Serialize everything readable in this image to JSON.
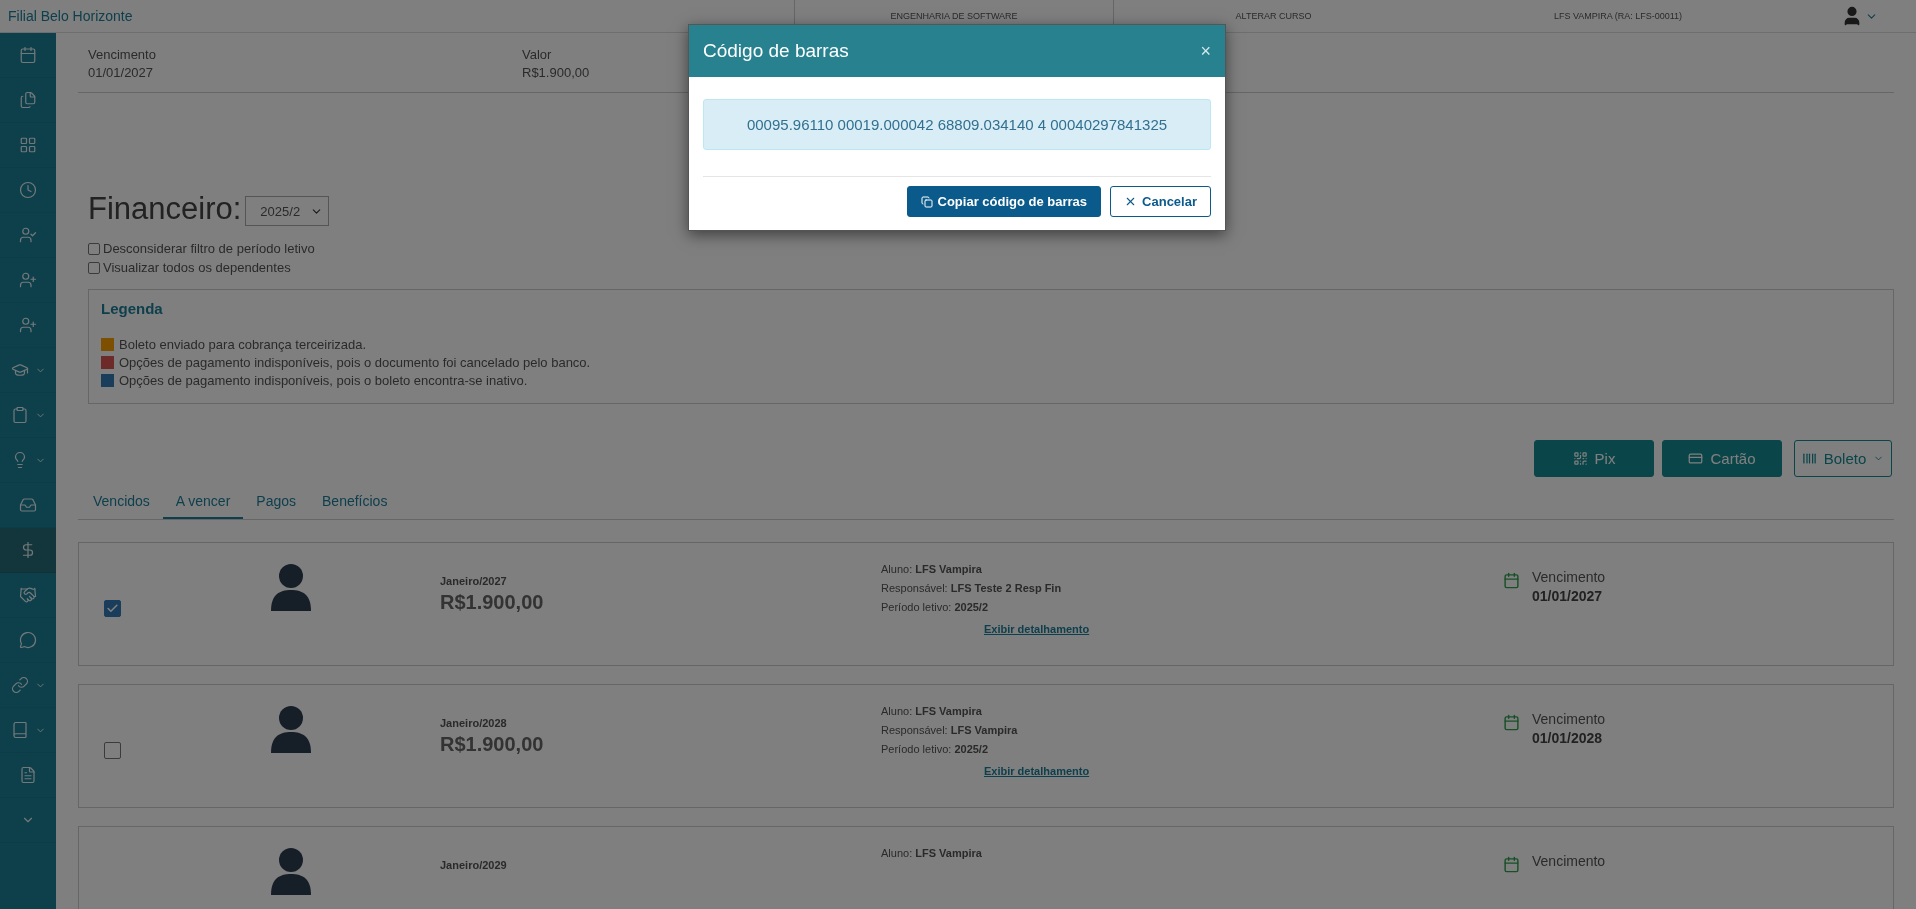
{
  "topbar": {
    "branch": "Filial Belo Horizonte",
    "course": "ENGENHARIA DE SOFTWARE",
    "change_course": "ALTERAR CURSO",
    "user": "LFS VAMPIRA (RA: LFS-00011)"
  },
  "sidebar": {
    "items": [
      {
        "selected": false,
        "has_submenu": false
      },
      {
        "selected": false,
        "has_submenu": false
      },
      {
        "selected": false,
        "has_submenu": false
      },
      {
        "selected": false,
        "has_submenu": false
      },
      {
        "selected": false,
        "has_submenu": false
      },
      {
        "selected": false,
        "has_submenu": false
      },
      {
        "selected": false,
        "has_submenu": false
      },
      {
        "selected": false,
        "has_submenu": true
      },
      {
        "selected": false,
        "has_submenu": true
      },
      {
        "selected": false,
        "has_submenu": true
      },
      {
        "selected": false,
        "has_submenu": false
      },
      {
        "selected": true,
        "has_submenu": false
      },
      {
        "selected": false,
        "has_submenu": false
      },
      {
        "selected": false,
        "has_submenu": false
      },
      {
        "selected": false,
        "has_submenu": true
      },
      {
        "selected": false,
        "has_submenu": true
      },
      {
        "selected": false,
        "has_submenu": false
      },
      {
        "selected": false,
        "has_submenu": false
      }
    ]
  },
  "summary": [
    {
      "label": "Vencimento",
      "value": "01/01/2027"
    },
    {
      "label": "Valor",
      "value": "R$1.900,00"
    }
  ],
  "title": "Financeiro:",
  "period_select": {
    "value": "2025/2"
  },
  "options": [
    {
      "label": "Desconsiderar filtro de período letivo",
      "checked": false
    },
    {
      "label": "Visualizar todos os dependentes",
      "checked": false
    }
  ],
  "legend": {
    "title": "Legenda",
    "items": [
      {
        "text": "Boleto enviado para cobrança terceirizada.",
        "color": "#7d4f00"
      },
      {
        "text": "Opções de pagamento indisponíveis, pois o documento foi cancelado pelo banco.",
        "color": "#6c2a28"
      },
      {
        "text": "Opções de pagamento indisponíveis, pois o boleto encontra-se inativo.",
        "color": "#1a3d5c"
      }
    ]
  },
  "actions": [
    {
      "label": "Pix",
      "kind": "qr"
    },
    {
      "label": "Cartão",
      "kind": "card"
    },
    {
      "label": "Boleto",
      "kind": "barcode-menu"
    }
  ],
  "tabs": [
    {
      "label": "Vencidos",
      "selected": false
    },
    {
      "label": "A vencer",
      "selected": true
    },
    {
      "label": "Pagos",
      "selected": false
    },
    {
      "label": "Benefícios",
      "selected": false
    }
  ],
  "cards": [
    {
      "checked": true,
      "month": "Janeiro/2027",
      "amount": "R$1.900,00",
      "aluno_label": "Aluno:",
      "aluno": "LFS Vampira",
      "responsavel_label": "Responsável:",
      "responsavel": "LFS Teste 2 Resp Fin",
      "periodo_label": "Período letivo:",
      "periodo": "2025/2",
      "link": "Exibir detalhamento",
      "due_label": "Vencimento",
      "due_date": "01/01/2027"
    },
    {
      "checked": false,
      "month": "Janeiro/2028",
      "amount": "R$1.900,00",
      "aluno_label": "Aluno:",
      "aluno": "LFS Vampira",
      "responsavel_label": "Responsável:",
      "responsavel": "LFS Vampira",
      "periodo_label": "Período letivo:",
      "periodo": "2025/2",
      "link": "Exibir detalhamento",
      "due_label": "Vencimento",
      "due_date": "01/01/2028"
    },
    {
      "month": "Janeiro/2029",
      "aluno_label": "Aluno:",
      "aluno": "LFS Vampira",
      "due_label": "Vencimento"
    }
  ],
  "modal": {
    "title": "Código de barras",
    "close": "×",
    "barcode": "00095.96110 00019.000042 68809.034140 4 00040297841325",
    "buttons": [
      {
        "label": "Copiar código de barras",
        "kind": "primary"
      },
      {
        "label": "Cancelar",
        "kind": "secondary"
      }
    ]
  }
}
